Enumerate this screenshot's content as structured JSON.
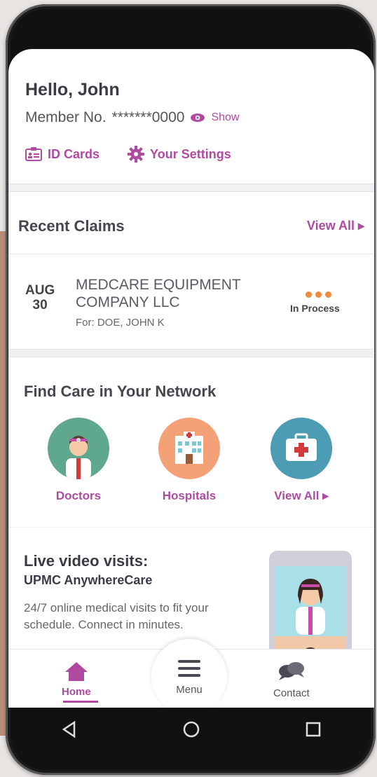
{
  "header": {
    "greeting": "Hello, John",
    "member_label": "Member No.",
    "member_number": "*******0000",
    "show_label": "Show",
    "id_cards_label": "ID Cards",
    "settings_label": "Your Settings"
  },
  "claims": {
    "heading": "Recent Claims",
    "view_all": "View All ▸",
    "item": {
      "month": "AUG",
      "day": "30",
      "provider_line1": "MEDCARE EQUIPMENT",
      "provider_line2": "COMPANY LLC",
      "for": "For: DOE, JOHN K",
      "status": "In Process"
    }
  },
  "care": {
    "heading": "Find Care in Your Network",
    "items": [
      {
        "label": "Doctors",
        "icon": "doctor-icon"
      },
      {
        "label": "Hospitals",
        "icon": "hospital-icon"
      },
      {
        "label": "View All ▸",
        "icon": "first-aid-kit-icon"
      }
    ]
  },
  "live": {
    "title": "Live video visits:",
    "subtitle": "UPMC AnywhereCare",
    "description": "24/7 online medical visits to fit your schedule. Connect in minutes."
  },
  "nav": {
    "home": "Home",
    "menu": "Menu",
    "contact": "Contact"
  },
  "colors": {
    "accent": "#b04aa0",
    "status_dots": "#ef8a3e",
    "doctor_bg": "#5fa88e",
    "hospital_bg": "#f5a178",
    "kit_bg": "#4c9db4"
  }
}
